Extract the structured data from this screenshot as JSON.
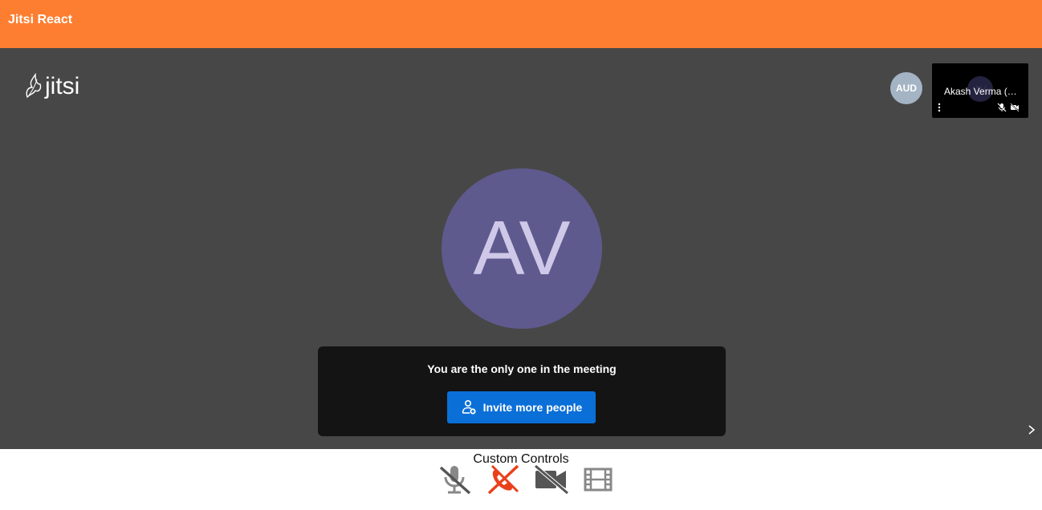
{
  "app": {
    "title": "Jitsi React"
  },
  "logo": {
    "text": "jitsi"
  },
  "participants": {
    "audio_avatar_initials": "AUD",
    "thumbnail": {
      "name": "Akash Verma (…",
      "initials": "AV"
    }
  },
  "main": {
    "avatar_initials": "AV",
    "notice_text": "You are the only one in the meeting",
    "invite_label": "Invite more people"
  },
  "controls": {
    "label": "Custom Controls",
    "buttons": [
      {
        "name": "mic-muted",
        "icon": "mic-off-icon"
      },
      {
        "name": "hangup",
        "icon": "phone-off-icon"
      },
      {
        "name": "camera-off",
        "icon": "video-off-icon"
      },
      {
        "name": "film",
        "icon": "film-icon"
      }
    ]
  },
  "colors": {
    "header": "#fd7e30",
    "meeting_bg": "#474747",
    "avatar": "#5e5a8e",
    "invite_button": "#0b6fd8",
    "hangup": "#e9401c"
  }
}
